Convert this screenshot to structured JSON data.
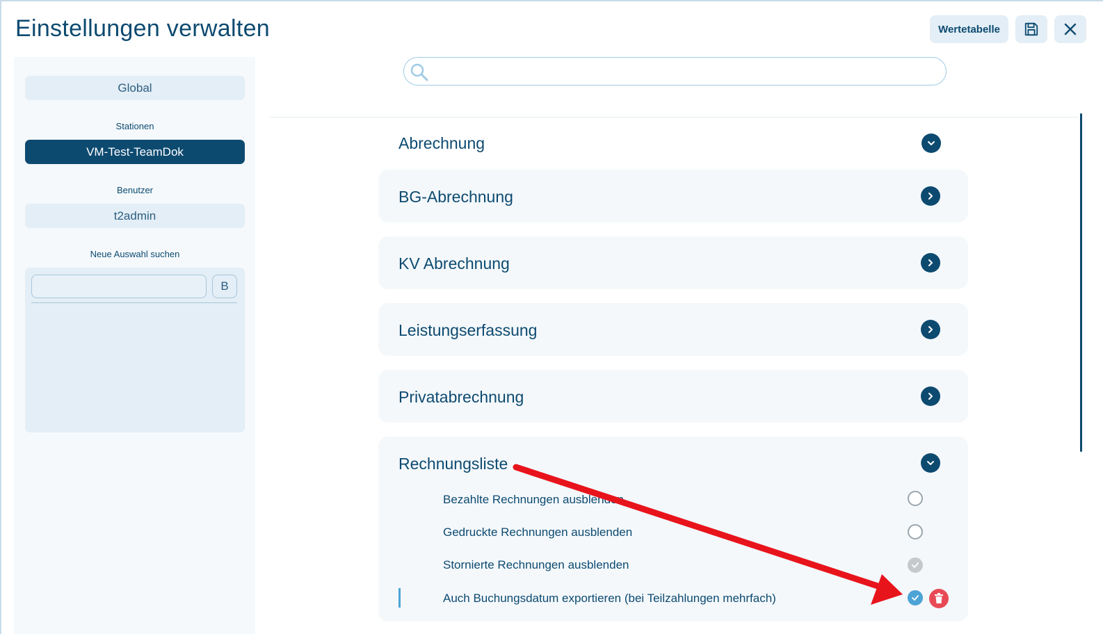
{
  "window": {
    "title": "Einstellungen verwalten"
  },
  "toolbar": {
    "values_table_label": "Wertetabelle",
    "save_icon": "floppy-disk",
    "close_icon": "x"
  },
  "sidebar": {
    "global_label": "Global",
    "stations_heading": "Stationen",
    "station_selected": "VM-Test-TeamDok",
    "users_heading": "Benutzer",
    "user_value": "t2admin",
    "new_search_heading": "Neue Auswahl suchen",
    "search_button_label": "B",
    "search_value": ""
  },
  "main": {
    "search_placeholder": "",
    "sections": [
      {
        "title": "Abrechnung",
        "expanded": true
      },
      {
        "title": "BG-Abrechnung",
        "expanded": false
      },
      {
        "title": "KV Abrechnung",
        "expanded": false
      },
      {
        "title": "Leistungserfassung",
        "expanded": false
      },
      {
        "title": "Privatabrechnung",
        "expanded": false
      },
      {
        "title": "Rechnungsliste",
        "expanded": true,
        "options": [
          {
            "label": "Bezahlte Rechnungen ausblenden",
            "state": "unchecked"
          },
          {
            "label": "Gedruckte Rechnungen ausblenden",
            "state": "unchecked"
          },
          {
            "label": "Stornierte Rechnungen ausblenden",
            "state": "default-checked"
          },
          {
            "label": "Auch Buchungsdatum exportieren (bei Teilzahlungen mehrfach)",
            "state": "checked"
          }
        ]
      }
    ]
  },
  "annotation": {
    "type": "arrow",
    "color": "#e8141c"
  },
  "colors": {
    "primary": "#0d4a70",
    "accent": "#4da3d6",
    "danger": "#e84a55",
    "panel": "#f4f8fb"
  }
}
